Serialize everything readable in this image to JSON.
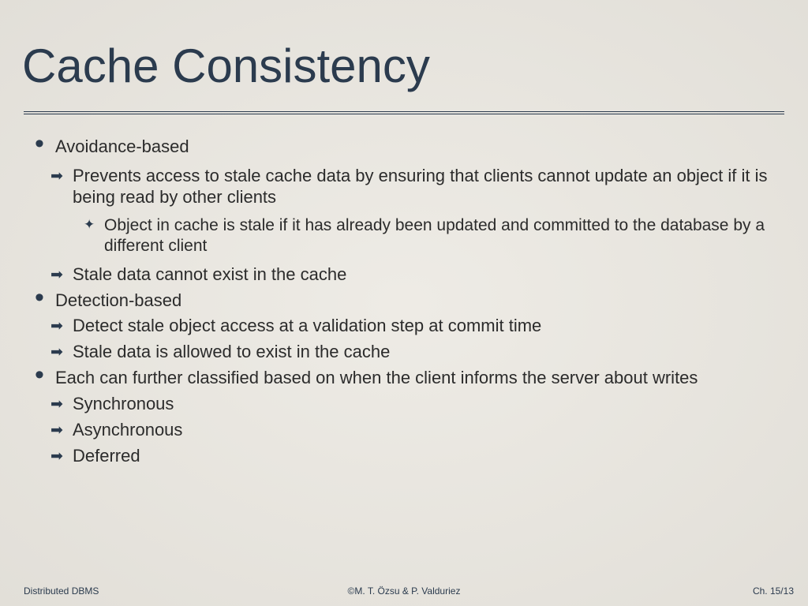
{
  "title": "Cache Consistency",
  "b1": {
    "head": "Avoidance-based",
    "a1": "Prevents access to stale cache data by ensuring that clients cannot update an object if it is being read by other clients",
    "s1": "Object in cache is stale if it has already been updated and committed to the database by a different client",
    "a2": "Stale data cannot exist in the cache"
  },
  "b2": {
    "head": "Detection-based",
    "a1": "Detect stale object access at a validation step at commit time",
    "a2": "Stale data is allowed to exist in the cache"
  },
  "b3": {
    "head": "Each can further classified based on when the client informs the server about writes",
    "a1": "Synchronous",
    "a2": "Asynchronous",
    "a3": "Deferred"
  },
  "footer": {
    "left": "Distributed DBMS",
    "center": "©M. T. Özsu & P. Valduriez",
    "right": "Ch. 15/13"
  }
}
